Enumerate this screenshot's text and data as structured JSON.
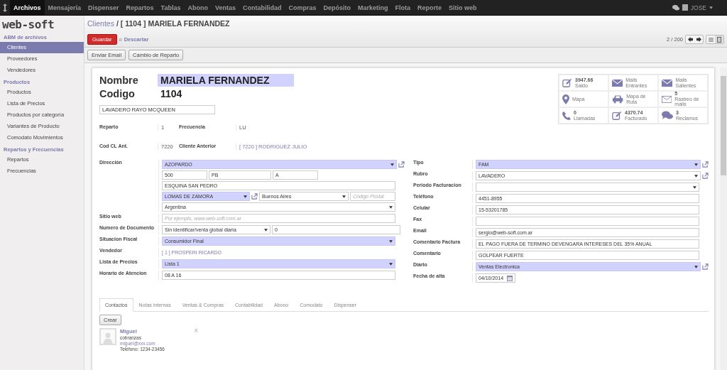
{
  "topbar": {
    "menu": [
      {
        "label": "Archivos",
        "selected": true
      },
      {
        "label": "Mensajería",
        "selected": false
      },
      {
        "label": "Dispenser",
        "selected": false
      },
      {
        "label": "Repartos",
        "selected": false
      },
      {
        "label": "Tablas",
        "selected": false
      },
      {
        "label": "Abono",
        "selected": false
      },
      {
        "label": "Ventas",
        "selected": false
      },
      {
        "label": "Contabilidad",
        "selected": false
      },
      {
        "label": "Compras",
        "selected": false
      },
      {
        "label": "Depósito",
        "selected": false
      },
      {
        "label": "Marketing",
        "selected": false
      },
      {
        "label": "Flota",
        "selected": false
      },
      {
        "label": "Reporte",
        "selected": false
      },
      {
        "label": "Sitio web",
        "selected": false
      }
    ],
    "user": "JOSE"
  },
  "sidebar": {
    "logo": "web-soft",
    "sections": [
      {
        "title": "ABM de archivos",
        "items": [
          {
            "label": "Clientes",
            "selected": true
          },
          {
            "label": "Proveedores",
            "selected": false
          },
          {
            "label": "Vendedores",
            "selected": false
          }
        ]
      },
      {
        "title": "Productos",
        "items": [
          {
            "label": "Productos",
            "selected": false
          },
          {
            "label": "Lista de Precios",
            "selected": false
          },
          {
            "label": "Productos por categoría",
            "selected": false
          },
          {
            "label": "Variantes de Producto",
            "selected": false
          },
          {
            "label": "Comodato Movimientos",
            "selected": false
          }
        ]
      },
      {
        "title": "Repartos y Frecuencias",
        "items": [
          {
            "label": "Repartos",
            "selected": false
          },
          {
            "label": "Frecuencias",
            "selected": false
          }
        ]
      }
    ]
  },
  "breadcrumb": {
    "parent": "Clientes",
    "separator": "/",
    "current": "[ 1104 ] MARIELA FERNANDEZ"
  },
  "actions": {
    "save": "Guardar",
    "or": "o",
    "discard": "Descartar"
  },
  "pager": {
    "text": "2 / 200",
    "views": [
      {
        "kind": "list",
        "selected": false
      },
      {
        "kind": "form",
        "selected": true
      }
    ]
  },
  "buttons": [
    "Enviar Email",
    "Cambio de Reparto"
  ],
  "header": {
    "name_label": "Nombre",
    "name": "MARIELA FERNANDEZ",
    "code_label": "Codigo",
    "code": "1104",
    "alias": "LAVADERO RAYO MCQUEEN"
  },
  "stats": [
    {
      "kind": "edit",
      "value": "3947.66",
      "label": "Saldo"
    },
    {
      "kind": "mail",
      "label": "Mails Entrantes"
    },
    {
      "kind": "mail",
      "label": "Mails Salientes"
    },
    {
      "kind": "pin",
      "label": "Mapa"
    },
    {
      "kind": "car",
      "label": "Mapa de Ruta"
    },
    {
      "kind": "envelope",
      "value": "5",
      "label": "Rastreo de mails"
    },
    {
      "kind": "phone",
      "value": "0",
      "label": "Llamadas"
    },
    {
      "kind": "edit",
      "value": "4370.74",
      "label": "Facturado"
    },
    {
      "kind": "chat",
      "value": "3",
      "label": "Reclamos"
    }
  ],
  "info": [
    {
      "label": "Reparto",
      "value": "1",
      "label2": "Frecuencia",
      "value2": "LU",
      "link2": false
    },
    {
      "label": "Cod CL Ant.",
      "value": "7220",
      "label2": "Cliente Anterior",
      "value2": "[ 7220 ] RODRIGUEZ JULIO",
      "link2": true
    }
  ],
  "address": {
    "label": "Dirección",
    "street": "AZOPARDO",
    "number": "500",
    "floor": "PB",
    "apartment": "A",
    "street2": "ESQUINA SAN PEDRO",
    "city": "LOMAS DE ZAMORA",
    "state": "Buenos Aires",
    "zip_placeholder": "Código Postal",
    "country": "Argentina"
  },
  "left_fields": [
    {
      "kind": "input",
      "label": "Sitio web",
      "placeholder": "Por ejemplo, www.web-soft.com.ar"
    },
    {
      "kind": "document",
      "label": "Numero de Documento",
      "value": "Sin identificar/venta global diaria",
      "value2": "0"
    },
    {
      "kind": "select",
      "label": "Situacion Fiscal",
      "value": "Consumidor Final",
      "required": true,
      "external": false
    },
    {
      "kind": "link",
      "label": "Vendedor",
      "value": "[ 1 ] PROSPERI RICARDO"
    },
    {
      "kind": "select",
      "label": "Lista de Precios",
      "value": "Lista 1",
      "required": true,
      "external": false
    },
    {
      "kind": "input",
      "label": "Horario de Atencion",
      "value": "08 A 16"
    }
  ],
  "right_fields": [
    {
      "kind": "select",
      "label": "Tipo",
      "value": "FAM",
      "required": true,
      "external": true
    },
    {
      "kind": "select",
      "label": "Rubro",
      "value": "LAVADERO",
      "required": false,
      "external": true
    },
    {
      "kind": "select",
      "label": "Periodo Facturacion",
      "required": false,
      "external": false
    },
    {
      "kind": "input",
      "label": "Teléfono",
      "value": "4451-8955"
    },
    {
      "kind": "input",
      "label": "Celular",
      "value": "15-53201785"
    },
    {
      "kind": "input",
      "label": "Fax"
    },
    {
      "kind": "input",
      "label": "Email",
      "value": "sergio@web-soft.com.ar"
    },
    {
      "kind": "input",
      "label": "Comentario Factura",
      "value": "EL PAGO FUERA DE TERMINO DEVENGARA INTERESES DEL 35% ANUAL"
    },
    {
      "kind": "input",
      "label": "Comentario",
      "value": "GOLPEAR FUERTE"
    },
    {
      "kind": "select",
      "label": "Diario",
      "value": "Ventas Electronica",
      "required": true,
      "external": true
    },
    {
      "kind": "date",
      "label": "Fecha de alta",
      "value": "04/10/2014"
    }
  ],
  "tabs": [
    {
      "label": "Contactos",
      "selected": true
    },
    {
      "label": "Notas internas",
      "selected": false
    },
    {
      "label": "Ventas & Compras",
      "selected": false
    },
    {
      "label": "Contabilidad",
      "selected": false
    },
    {
      "label": "Abono",
      "selected": false
    },
    {
      "label": "Comodato",
      "selected": false
    },
    {
      "label": "Dispenser",
      "selected": false
    }
  ],
  "create_button": "Crear",
  "contacts": [
    {
      "name": "Miguel",
      "role": "cobranzas",
      "email": "miguel@xxx.com",
      "phone": "Teléfono: 1234-23456",
      "remove": "X"
    }
  ]
}
